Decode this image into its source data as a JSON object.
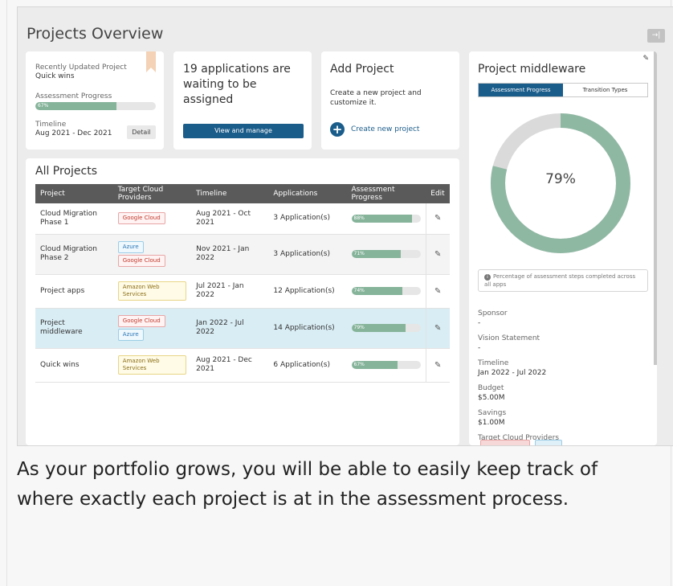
{
  "page_title": "Projects Overview",
  "collapse_icon": "→|",
  "recent_card": {
    "label": "Recently Updated Project",
    "project": "Quick wins",
    "progress_label": "Assessment Progress",
    "progress": 0.67,
    "progress_text": "67%",
    "timeline_label": "Timeline",
    "timeline": "Aug 2021 - Dec 2021",
    "detail_button": "Detail"
  },
  "waiting_card": {
    "message": "19 applications are waiting to be assigned",
    "button": "View and manage"
  },
  "add_card": {
    "title": "Add Project",
    "description": "Create a new project and customize it.",
    "link": "Create new project"
  },
  "all_projects": {
    "title": "All Projects",
    "columns": [
      "Project",
      "Target Cloud Providers",
      "Timeline",
      "Applications",
      "Assessment Progress",
      "Edit"
    ],
    "rows": [
      {
        "project": "Cloud Migration Phase 1",
        "providers": [
          {
            "name": "Google Cloud",
            "color": "red"
          }
        ],
        "timeline": "Aug 2021 - Oct 2021",
        "applications": "3 Application(s)",
        "progress": 0.88,
        "progress_text": "88%"
      },
      {
        "project": "Cloud Migration Phase 2",
        "providers": [
          {
            "name": "Azure",
            "color": "blue"
          },
          {
            "name": "Google Cloud",
            "color": "red"
          }
        ],
        "timeline": "Nov 2021 - Jan 2022",
        "applications": "3 Application(s)",
        "progress": 0.71,
        "progress_text": "71%"
      },
      {
        "project": "Project apps",
        "providers": [
          {
            "name": "Amazon Web Services",
            "color": "yellow"
          }
        ],
        "timeline": "Jul 2021 - Jan 2022",
        "applications": "12 Application(s)",
        "progress": 0.74,
        "progress_text": "74%"
      },
      {
        "project": "Project middleware",
        "providers": [
          {
            "name": "Google Cloud",
            "color": "red"
          },
          {
            "name": "Azure",
            "color": "blue"
          }
        ],
        "timeline": "Jan 2022 - Jul 2022",
        "applications": "14 Application(s)",
        "progress": 0.79,
        "progress_text": "79%"
      },
      {
        "project": "Quick wins",
        "providers": [
          {
            "name": "Amazon Web Services",
            "color": "yellow"
          }
        ],
        "timeline": "Aug 2021 - Dec 2021",
        "applications": "6 Application(s)",
        "progress": 0.67,
        "progress_text": "67%"
      }
    ]
  },
  "detail_panel": {
    "title": "Project middleware",
    "tabs": [
      "Assessment Progress",
      "Transition Types"
    ],
    "percent": 0.79,
    "percent_text": "79%",
    "note": "Percentage of assessment steps completed across all apps",
    "sponsor_label": "Sponsor",
    "sponsor": "-",
    "vision_label": "Vision Statement",
    "vision": "-",
    "timeline_label": "Timeline",
    "timeline": "Jan 2022 - Jul 2022",
    "budget_label": "Budget",
    "budget": "$5.00M",
    "savings_label": "Savings",
    "savings": "$1.00M",
    "providers_label": "Target Cloud Providers"
  },
  "caption": "As your portfolio grows, you will be able to easily keep track of where exactly each project is at in the assessment process.",
  "colors": {
    "navy": "#1a5c8a",
    "progress_green": "#86b49a",
    "donut_track": "#dadada",
    "header_gray": "#5a5a5a",
    "selected_row": "#d9edf4"
  }
}
